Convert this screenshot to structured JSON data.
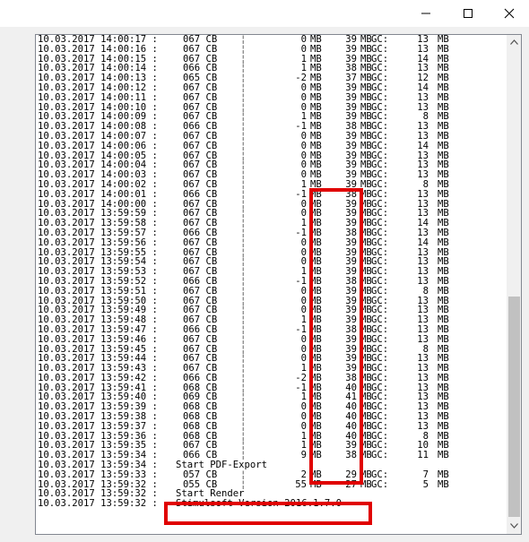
{
  "window": {
    "controls": [
      {
        "name": "minimize",
        "icon": "minimize-icon"
      },
      {
        "name": "maximize",
        "icon": "maximize-icon"
      },
      {
        "name": "close",
        "icon": "close-icon"
      }
    ]
  },
  "log": {
    "rows": [
      {
        "ts": "10.03.2017 14:00:17 :",
        "id": "067 CB",
        "delta": "0",
        "mb1": "MB",
        "total": "39",
        "mb2": "MB",
        "gc_label": "GC:",
        "gc": "13",
        "mb3": "MB"
      },
      {
        "ts": "10.03.2017 14:00:16 :",
        "id": "067 CB",
        "delta": "0",
        "mb1": "MB",
        "total": "39",
        "mb2": "MB",
        "gc_label": "GC:",
        "gc": "13",
        "mb3": "MB"
      },
      {
        "ts": "10.03.2017 14:00:15 :",
        "id": "067 CB",
        "delta": "1",
        "mb1": "MB",
        "total": "39",
        "mb2": "MB",
        "gc_label": "GC:",
        "gc": "14",
        "mb3": "MB"
      },
      {
        "ts": "10.03.2017 14:00:14 :",
        "id": "066 CB",
        "delta": "1",
        "mb1": "MB",
        "total": "38",
        "mb2": "MB",
        "gc_label": "GC:",
        "gc": "13",
        "mb3": "MB"
      },
      {
        "ts": "10.03.2017 14:00:13 :",
        "id": "065 CB",
        "delta": "-2",
        "mb1": "MB",
        "total": "37",
        "mb2": "MB",
        "gc_label": "GC:",
        "gc": "12",
        "mb3": "MB"
      },
      {
        "ts": "10.03.2017 14:00:12 :",
        "id": "067 CB",
        "delta": "0",
        "mb1": "MB",
        "total": "39",
        "mb2": "MB",
        "gc_label": "GC:",
        "gc": "14",
        "mb3": "MB"
      },
      {
        "ts": "10.03.2017 14:00:11 :",
        "id": "067 CB",
        "delta": "0",
        "mb1": "MB",
        "total": "39",
        "mb2": "MB",
        "gc_label": "GC:",
        "gc": "13",
        "mb3": "MB"
      },
      {
        "ts": "10.03.2017 14:00:10 :",
        "id": "067 CB",
        "delta": "0",
        "mb1": "MB",
        "total": "39",
        "mb2": "MB",
        "gc_label": "GC:",
        "gc": "13",
        "mb3": "MB"
      },
      {
        "ts": "10.03.2017 14:00:09 :",
        "id": "067 CB",
        "delta": "1",
        "mb1": "MB",
        "total": "39",
        "mb2": "MB",
        "gc_label": "GC:",
        "gc": "8",
        "mb3": "MB"
      },
      {
        "ts": "10.03.2017 14:00:08 :",
        "id": "066 CB",
        "delta": "-1",
        "mb1": "MB",
        "total": "38",
        "mb2": "MB",
        "gc_label": "GC:",
        "gc": "13",
        "mb3": "MB"
      },
      {
        "ts": "10.03.2017 14:00:07 :",
        "id": "067 CB",
        "delta": "0",
        "mb1": "MB",
        "total": "39",
        "mb2": "MB",
        "gc_label": "GC:",
        "gc": "13",
        "mb3": "MB"
      },
      {
        "ts": "10.03.2017 14:00:06 :",
        "id": "067 CB",
        "delta": "0",
        "mb1": "MB",
        "total": "39",
        "mb2": "MB",
        "gc_label": "GC:",
        "gc": "14",
        "mb3": "MB"
      },
      {
        "ts": "10.03.2017 14:00:05 :",
        "id": "067 CB",
        "delta": "0",
        "mb1": "MB",
        "total": "39",
        "mb2": "MB",
        "gc_label": "GC:",
        "gc": "13",
        "mb3": "MB"
      },
      {
        "ts": "10.03.2017 14:00:04 :",
        "id": "067 CB",
        "delta": "0",
        "mb1": "MB",
        "total": "39",
        "mb2": "MB",
        "gc_label": "GC:",
        "gc": "13",
        "mb3": "MB"
      },
      {
        "ts": "10.03.2017 14:00:03 :",
        "id": "067 CB",
        "delta": "0",
        "mb1": "MB",
        "total": "39",
        "mb2": "MB",
        "gc_label": "GC:",
        "gc": "13",
        "mb3": "MB"
      },
      {
        "ts": "10.03.2017 14:00:02 :",
        "id": "067 CB",
        "delta": "1",
        "mb1": "MB",
        "total": "39",
        "mb2": "MB",
        "gc_label": "GC:",
        "gc": "8",
        "mb3": "MB"
      },
      {
        "ts": "10.03.2017 14:00:01 :",
        "id": "066 CB",
        "delta": "-1",
        "mb1": "MB",
        "total": "38",
        "mb2": "MB",
        "gc_label": "GC:",
        "gc": "13",
        "mb3": "MB"
      },
      {
        "ts": "10.03.2017 14:00:00 :",
        "id": "067 CB",
        "delta": "0",
        "mb1": "MB",
        "total": "39",
        "mb2": "MB",
        "gc_label": "GC:",
        "gc": "13",
        "mb3": "MB"
      },
      {
        "ts": "10.03.2017 13:59:59 :",
        "id": "067 CB",
        "delta": "0",
        "mb1": "MB",
        "total": "39",
        "mb2": "MB",
        "gc_label": "GC:",
        "gc": "13",
        "mb3": "MB"
      },
      {
        "ts": "10.03.2017 13:59:58 :",
        "id": "067 CB",
        "delta": "1",
        "mb1": "MB",
        "total": "39",
        "mb2": "MB",
        "gc_label": "GC:",
        "gc": "14",
        "mb3": "MB"
      },
      {
        "ts": "10.03.2017 13:59:57 :",
        "id": "066 CB",
        "delta": "-1",
        "mb1": "MB",
        "total": "38",
        "mb2": "MB",
        "gc_label": "GC:",
        "gc": "13",
        "mb3": "MB"
      },
      {
        "ts": "10.03.2017 13:59:56 :",
        "id": "067 CB",
        "delta": "0",
        "mb1": "MB",
        "total": "39",
        "mb2": "MB",
        "gc_label": "GC:",
        "gc": "14",
        "mb3": "MB"
      },
      {
        "ts": "10.03.2017 13:59:55 :",
        "id": "067 CB",
        "delta": "0",
        "mb1": "MB",
        "total": "39",
        "mb2": "MB",
        "gc_label": "GC:",
        "gc": "13",
        "mb3": "MB"
      },
      {
        "ts": "10.03.2017 13:59:54 :",
        "id": "067 CB",
        "delta": "0",
        "mb1": "MB",
        "total": "39",
        "mb2": "MB",
        "gc_label": "GC:",
        "gc": "13",
        "mb3": "MB"
      },
      {
        "ts": "10.03.2017 13:59:53 :",
        "id": "067 CB",
        "delta": "1",
        "mb1": "MB",
        "total": "39",
        "mb2": "MB",
        "gc_label": "GC:",
        "gc": "13",
        "mb3": "MB"
      },
      {
        "ts": "10.03.2017 13:59:52 :",
        "id": "066 CB",
        "delta": "-1",
        "mb1": "MB",
        "total": "38",
        "mb2": "MB",
        "gc_label": "GC:",
        "gc": "13",
        "mb3": "MB"
      },
      {
        "ts": "10.03.2017 13:59:51 :",
        "id": "067 CB",
        "delta": "0",
        "mb1": "MB",
        "total": "39",
        "mb2": "MB",
        "gc_label": "GC:",
        "gc": "8",
        "mb3": "MB"
      },
      {
        "ts": "10.03.2017 13:59:50 :",
        "id": "067 CB",
        "delta": "0",
        "mb1": "MB",
        "total": "39",
        "mb2": "MB",
        "gc_label": "GC:",
        "gc": "13",
        "mb3": "MB"
      },
      {
        "ts": "10.03.2017 13:59:49 :",
        "id": "067 CB",
        "delta": "0",
        "mb1": "MB",
        "total": "39",
        "mb2": "MB",
        "gc_label": "GC:",
        "gc": "13",
        "mb3": "MB"
      },
      {
        "ts": "10.03.2017 13:59:48 :",
        "id": "067 CB",
        "delta": "1",
        "mb1": "MB",
        "total": "39",
        "mb2": "MB",
        "gc_label": "GC:",
        "gc": "13",
        "mb3": "MB"
      },
      {
        "ts": "10.03.2017 13:59:47 :",
        "id": "066 CB",
        "delta": "-1",
        "mb1": "MB",
        "total": "38",
        "mb2": "MB",
        "gc_label": "GC:",
        "gc": "13",
        "mb3": "MB"
      },
      {
        "ts": "10.03.2017 13:59:46 :",
        "id": "067 CB",
        "delta": "0",
        "mb1": "MB",
        "total": "39",
        "mb2": "MB",
        "gc_label": "GC:",
        "gc": "13",
        "mb3": "MB"
      },
      {
        "ts": "10.03.2017 13:59:45 :",
        "id": "067 CB",
        "delta": "0",
        "mb1": "MB",
        "total": "39",
        "mb2": "MB",
        "gc_label": "GC:",
        "gc": "8",
        "mb3": "MB"
      },
      {
        "ts": "10.03.2017 13:59:44 :",
        "id": "067 CB",
        "delta": "0",
        "mb1": "MB",
        "total": "39",
        "mb2": "MB",
        "gc_label": "GC:",
        "gc": "13",
        "mb3": "MB"
      },
      {
        "ts": "10.03.2017 13:59:43 :",
        "id": "067 CB",
        "delta": "1",
        "mb1": "MB",
        "total": "39",
        "mb2": "MB",
        "gc_label": "GC:",
        "gc": "13",
        "mb3": "MB"
      },
      {
        "ts": "10.03.2017 13:59:42 :",
        "id": "066 CB",
        "delta": "-2",
        "mb1": "MB",
        "total": "38",
        "mb2": "MB",
        "gc_label": "GC:",
        "gc": "13",
        "mb3": "MB"
      },
      {
        "ts": "10.03.2017 13:59:41 :",
        "id": "068 CB",
        "delta": "-1",
        "mb1": "MB",
        "total": "40",
        "mb2": "MB",
        "gc_label": "GC:",
        "gc": "13",
        "mb3": "MB"
      },
      {
        "ts": "10.03.2017 13:59:40 :",
        "id": "069 CB",
        "delta": "1",
        "mb1": "MB",
        "total": "41",
        "mb2": "MB",
        "gc_label": "GC:",
        "gc": "13",
        "mb3": "MB"
      },
      {
        "ts": "10.03.2017 13:59:39 :",
        "id": "068 CB",
        "delta": "0",
        "mb1": "MB",
        "total": "40",
        "mb2": "MB",
        "gc_label": "GC:",
        "gc": "13",
        "mb3": "MB"
      },
      {
        "ts": "10.03.2017 13:59:38 :",
        "id": "068 CB",
        "delta": "0",
        "mb1": "MB",
        "total": "40",
        "mb2": "MB",
        "gc_label": "GC:",
        "gc": "13",
        "mb3": "MB"
      },
      {
        "ts": "10.03.2017 13:59:37 :",
        "id": "068 CB",
        "delta": "0",
        "mb1": "MB",
        "total": "40",
        "mb2": "MB",
        "gc_label": "GC:",
        "gc": "13",
        "mb3": "MB"
      },
      {
        "ts": "10.03.2017 13:59:36 :",
        "id": "068 CB",
        "delta": "1",
        "mb1": "MB",
        "total": "40",
        "mb2": "MB",
        "gc_label": "GC:",
        "gc": "8",
        "mb3": "MB"
      },
      {
        "ts": "10.03.2017 13:59:35 :",
        "id": "067 CB",
        "delta": "1",
        "mb1": "MB",
        "total": "39",
        "mb2": "MB",
        "gc_label": "GC:",
        "gc": "10",
        "mb3": "MB"
      },
      {
        "ts": "10.03.2017 13:59:34 :",
        "id": "066 CB",
        "delta": "9",
        "mb1": "MB",
        "total": "38",
        "mb2": "MB",
        "gc_label": "GC:",
        "gc": "11",
        "mb3": "MB"
      },
      {
        "ts": "10.03.2017 13:59:34 :",
        "msg": "Start PDF-Export"
      },
      {
        "ts": "10.03.2017 13:59:33 :",
        "id": "057 CB",
        "delta": "2",
        "mb1": "MB",
        "total": "29",
        "mb2": "MB",
        "gc_label": "GC:",
        "gc": "7",
        "mb3": "MB"
      },
      {
        "ts": "10.03.2017 13:59:32 :",
        "id": "055 CB",
        "delta": "55",
        "mb1": "MB",
        "total": "27",
        "mb2": "MB",
        "gc_label": "GC:",
        "gc": "5",
        "mb3": "MB"
      },
      {
        "ts": "10.03.2017 13:59:32 :",
        "msg": "Start Render"
      },
      {
        "ts": "10.03.2017 13:59:32 :",
        "msg": "Stimulsoft Version 2016.1.7.0"
      }
    ]
  },
  "colors": {
    "highlight": "#e00000",
    "scrollbar_thumb": "#c1c1c1"
  },
  "scrollbar": {
    "icons": [
      "scroll-up-icon",
      "scroll-down-icon"
    ]
  }
}
